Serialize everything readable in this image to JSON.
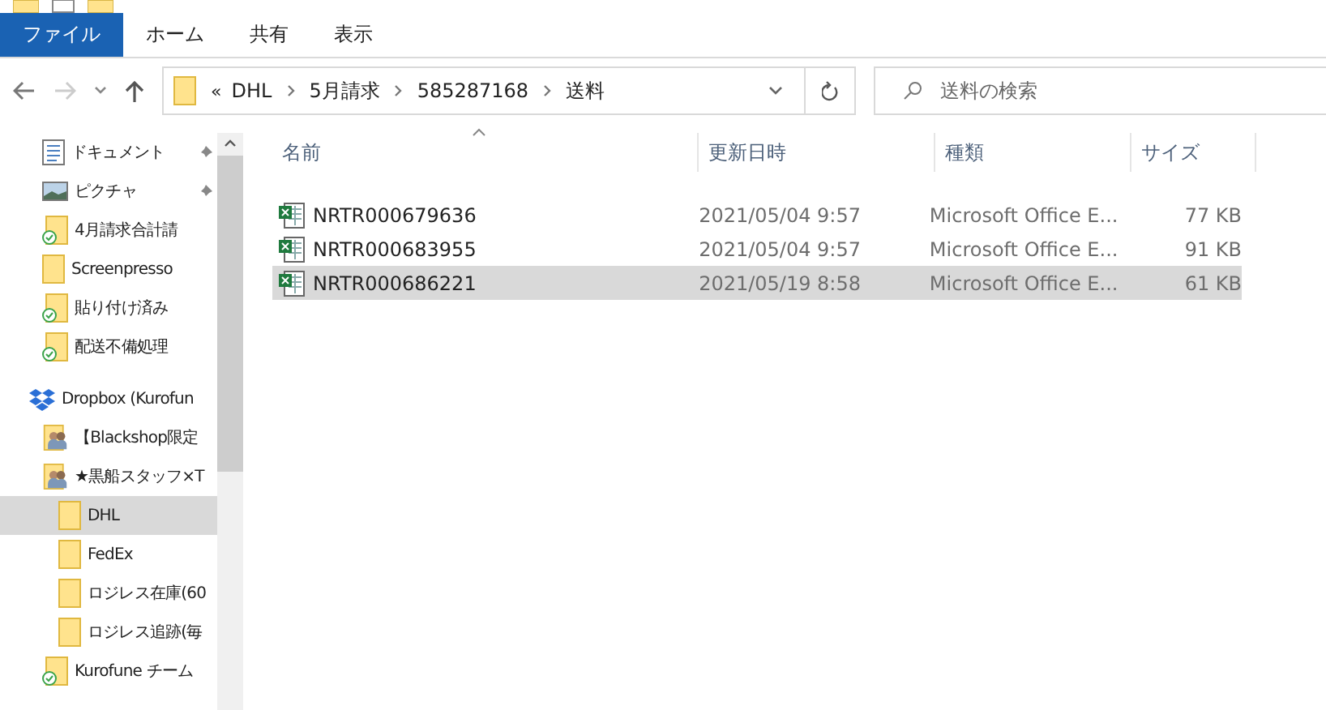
{
  "ribbon_tabs": [
    {
      "label": "ファイル",
      "selected": true
    },
    {
      "label": "ホーム",
      "selected": false
    },
    {
      "label": "共有",
      "selected": false
    },
    {
      "label": "表示",
      "selected": false
    }
  ],
  "address_bar": {
    "overflow": "«",
    "segments": [
      "DHL",
      "5月請求",
      "585287168",
      "送料"
    ]
  },
  "search": {
    "placeholder": "送料の検索"
  },
  "sidebar": {
    "items": [
      {
        "label": "ドキュメント",
        "kind": "document",
        "pinned": true,
        "selected": false,
        "indented": false
      },
      {
        "label": "ピクチャ",
        "kind": "picture",
        "pinned": true,
        "selected": false,
        "indented": false
      },
      {
        "label": "4月請求合計請",
        "kind": "synced-folder",
        "pinned": false,
        "selected": false,
        "indented": false
      },
      {
        "label": "Screenpresso",
        "kind": "folder",
        "pinned": false,
        "selected": false,
        "indented": false
      },
      {
        "label": "貼り付け済み",
        "kind": "synced-folder",
        "pinned": false,
        "selected": false,
        "indented": false
      },
      {
        "label": "配送不備処理",
        "kind": "synced-folder",
        "pinned": false,
        "selected": false,
        "indented": false
      },
      {
        "label": "Dropbox (Kurofun",
        "kind": "dropbox",
        "pinned": false,
        "selected": false,
        "indented": false
      },
      {
        "label": "【Blackshop限定",
        "kind": "shared-folder",
        "pinned": false,
        "selected": false,
        "indented": false
      },
      {
        "label": "★黒船スタッフ×T",
        "kind": "shared-folder",
        "pinned": false,
        "selected": false,
        "indented": false
      },
      {
        "label": "DHL",
        "kind": "folder",
        "pinned": false,
        "selected": true,
        "indented": true
      },
      {
        "label": "FedEx",
        "kind": "folder",
        "pinned": false,
        "selected": false,
        "indented": true
      },
      {
        "label": "ロジレス在庫(60",
        "kind": "folder",
        "pinned": false,
        "selected": false,
        "indented": true
      },
      {
        "label": "ロジレス追跡(毎",
        "kind": "folder",
        "pinned": false,
        "selected": false,
        "indented": true
      },
      {
        "label": "Kurofune チーム",
        "kind": "synced-folder",
        "pinned": false,
        "selected": false,
        "indented": false
      }
    ]
  },
  "table": {
    "columns": [
      "名前",
      "更新日時",
      "種類",
      "サイズ"
    ],
    "rows": [
      {
        "name": "NRTR000679636",
        "modified": "2021/05/04 9:57",
        "type": "Microsoft Office E...",
        "size": "77 KB",
        "selected": false
      },
      {
        "name": "NRTR000683955",
        "modified": "2021/05/04 9:57",
        "type": "Microsoft Office E...",
        "size": "91 KB",
        "selected": false
      },
      {
        "name": "NRTR000686221",
        "modified": "2021/05/19 8:58",
        "type": "Microsoft Office E...",
        "size": "61 KB",
        "selected": true
      }
    ]
  }
}
